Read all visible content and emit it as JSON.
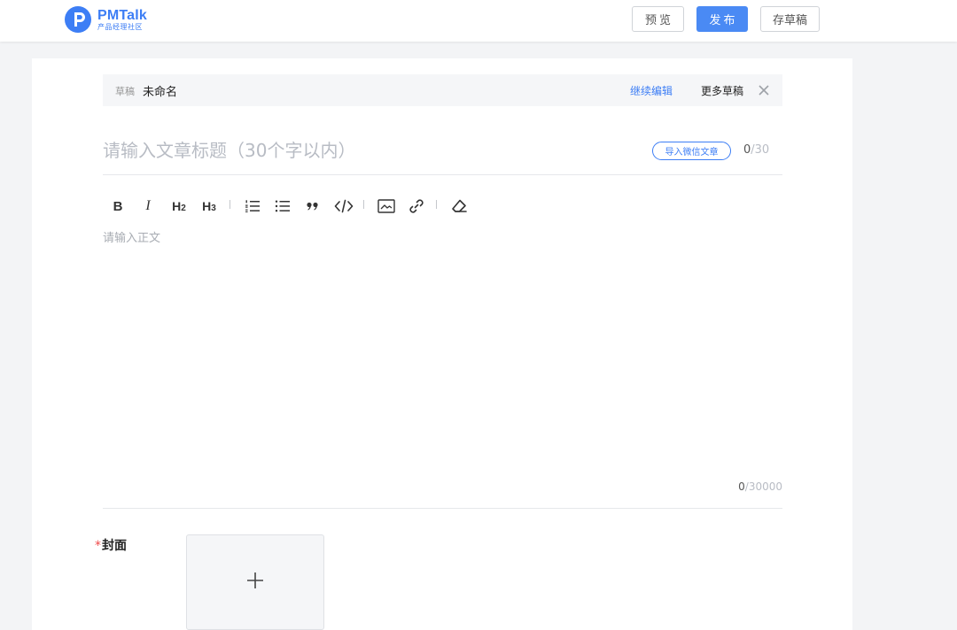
{
  "header": {
    "brand_name": "PMTalk",
    "brand_sub": "产品经理社区",
    "preview_label": "预览",
    "publish_label": "发布",
    "save_draft_label": "存草稿",
    "accent_color": "#3d7ef5"
  },
  "draft_bar": {
    "tag": "草稿",
    "name": "未命名",
    "continue_label": "继续编辑",
    "more_label": "更多草稿"
  },
  "title": {
    "placeholder": "请输入文章标题（30个字以内）",
    "value": "",
    "import_label": "导入微信文章",
    "count_current": "0",
    "count_max": "/30"
  },
  "toolbar": {
    "bold": "B",
    "italic": "I",
    "h2": "H",
    "h2_sub": "2",
    "h3": "H",
    "h3_sub": "3",
    "icons": [
      "bold-icon",
      "italic-icon",
      "heading2-icon",
      "heading3-icon",
      "ordered-list-icon",
      "bullet-list-icon",
      "quote-icon",
      "code-icon",
      "image-icon",
      "link-icon",
      "eraser-icon"
    ]
  },
  "body": {
    "placeholder": "请输入正文",
    "value": "",
    "count_current": "0",
    "count_max": "/30000"
  },
  "cover": {
    "required_mark": "*",
    "label": "封面",
    "add_icon": "plus-icon"
  }
}
